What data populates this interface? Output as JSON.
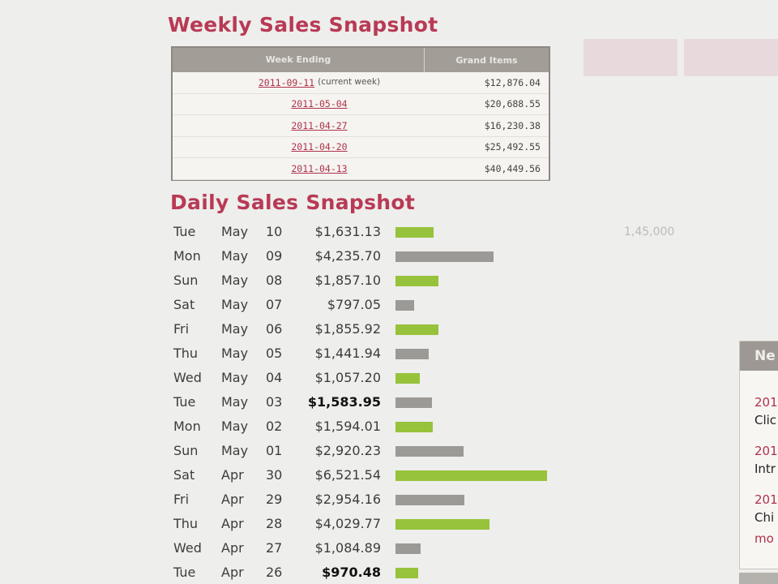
{
  "weekly": {
    "title": "Weekly Sales Snapshot",
    "header_week": "Week Ending",
    "header_amount": "Grand Items",
    "rows": [
      {
        "date": "2011-09-11",
        "note": "(current week)",
        "amount": "$12,876.04"
      },
      {
        "date": "2011-05-04",
        "note": "",
        "amount": "$20,688.55"
      },
      {
        "date": "2011-04-27",
        "note": "",
        "amount": "$16,230.38"
      },
      {
        "date": "2011-04-20",
        "note": "",
        "amount": "$25,492.55"
      },
      {
        "date": "2011-04-13",
        "note": "",
        "amount": "$40,449.56"
      }
    ]
  },
  "daily": {
    "title": "Daily Sales Snapshot",
    "max_value": 6521.54,
    "rows": [
      {
        "dow": "Tue",
        "month": "May",
        "day": "10",
        "amount": "$1,631.13",
        "value": 1631.13,
        "bold": false,
        "color": "green"
      },
      {
        "dow": "Mon",
        "month": "May",
        "day": "09",
        "amount": "$4,235.70",
        "value": 4235.7,
        "bold": false,
        "color": "gray"
      },
      {
        "dow": "Sun",
        "month": "May",
        "day": "08",
        "amount": "$1,857.10",
        "value": 1857.1,
        "bold": false,
        "color": "green"
      },
      {
        "dow": "Sat",
        "month": "May",
        "day": "07",
        "amount": "$797.05",
        "value": 797.05,
        "bold": false,
        "color": "gray"
      },
      {
        "dow": "Fri",
        "month": "May",
        "day": "06",
        "amount": "$1,855.92",
        "value": 1855.92,
        "bold": false,
        "color": "green"
      },
      {
        "dow": "Thu",
        "month": "May",
        "day": "05",
        "amount": "$1,441.94",
        "value": 1441.94,
        "bold": false,
        "color": "gray"
      },
      {
        "dow": "Wed",
        "month": "May",
        "day": "04",
        "amount": "$1,057.20",
        "value": 1057.2,
        "bold": false,
        "color": "green"
      },
      {
        "dow": "Tue",
        "month": "May",
        "day": "03",
        "amount": "$1,583.95",
        "value": 1583.95,
        "bold": true,
        "color": "gray"
      },
      {
        "dow": "Mon",
        "month": "May",
        "day": "02",
        "amount": "$1,594.01",
        "value": 1594.01,
        "bold": false,
        "color": "green"
      },
      {
        "dow": "Sun",
        "month": "May",
        "day": "01",
        "amount": "$2,920.23",
        "value": 2920.23,
        "bold": false,
        "color": "gray"
      },
      {
        "dow": "Sat",
        "month": "Apr",
        "day": "30",
        "amount": "$6,521.54",
        "value": 6521.54,
        "bold": false,
        "color": "green"
      },
      {
        "dow": "Fri",
        "month": "Apr",
        "day": "29",
        "amount": "$2,954.16",
        "value": 2954.16,
        "bold": false,
        "color": "gray"
      },
      {
        "dow": "Thu",
        "month": "Apr",
        "day": "28",
        "amount": "$4,029.77",
        "value": 4029.77,
        "bold": false,
        "color": "green"
      },
      {
        "dow": "Wed",
        "month": "Apr",
        "day": "27",
        "amount": "$1,084.89",
        "value": 1084.89,
        "bold": false,
        "color": "gray"
      },
      {
        "dow": "Tue",
        "month": "Apr",
        "day": "26",
        "amount": "$970.48",
        "value": 970.48,
        "bold": true,
        "color": "green"
      }
    ]
  },
  "side": {
    "faded_value": "1,45,000",
    "news_header": "Ne",
    "news_items": [
      {
        "year": "201",
        "text": "Clic"
      },
      {
        "year": "201",
        "text": "Intr"
      },
      {
        "year": "201",
        "text": "Chi"
      }
    ],
    "more": "mo"
  },
  "colors": {
    "title": "#b83a55",
    "bar_green": "#97c23b",
    "bar_gray": "#9c9a96",
    "link": "#b0324c"
  }
}
